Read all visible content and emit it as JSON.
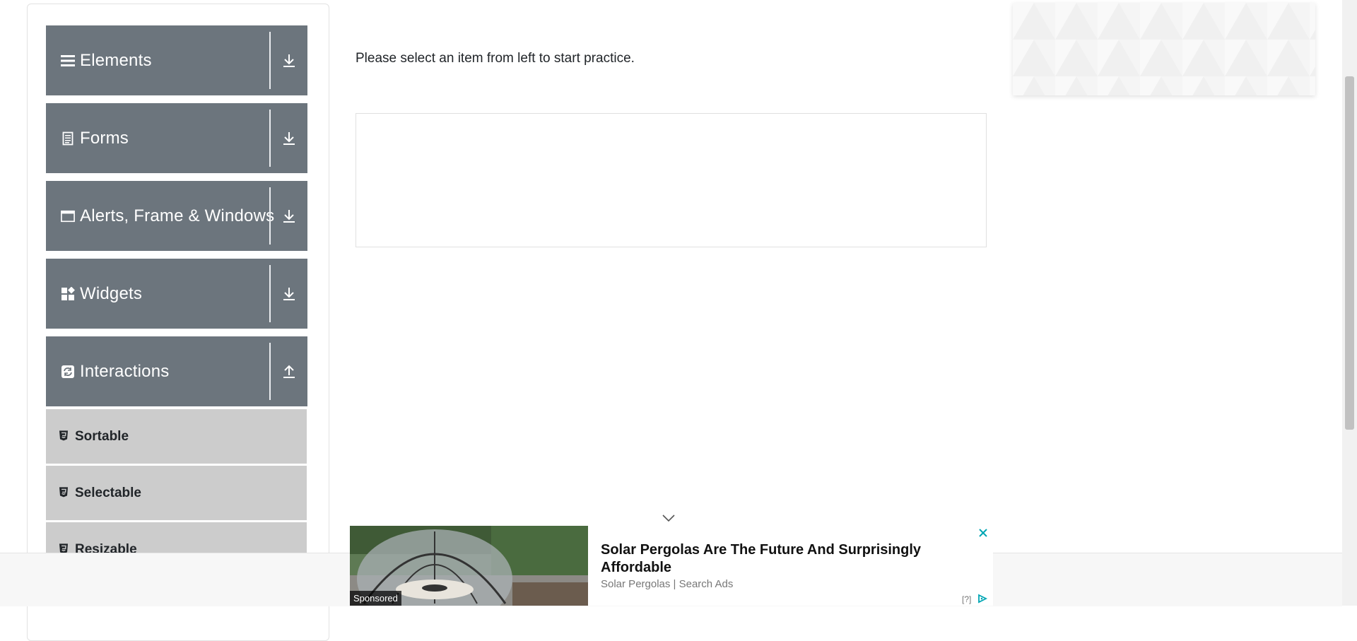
{
  "sidebar": {
    "groups": [
      {
        "label": "Elements",
        "icon": "menu-icon",
        "toggle": "download-arrow-icon"
      },
      {
        "label": "Forms",
        "icon": "document-icon",
        "toggle": "download-arrow-icon"
      },
      {
        "label": "Alerts, Frame & Windows",
        "icon": "window-icon",
        "toggle": "download-arrow-icon"
      },
      {
        "label": "Widgets",
        "icon": "widgets-icon",
        "toggle": "download-arrow-icon"
      },
      {
        "label": "Interactions",
        "icon": "refresh-icon",
        "toggle": "upload-arrow-icon"
      }
    ],
    "interaction_items": [
      {
        "label": "Sortable",
        "icon": "html5-icon"
      },
      {
        "label": "Selectable",
        "icon": "html5-icon"
      },
      {
        "label": "Resizable",
        "icon": "html5-icon"
      }
    ]
  },
  "main": {
    "prompt": "Please select an item from left to start practice."
  },
  "ad": {
    "headline": "Solar Pergolas Are The Future And Surprisingly Affordable",
    "source": "Solar Pergolas | Search Ads",
    "sponsored": "Sponsored",
    "help": "[?]",
    "close_icon": "close-icon",
    "info_icon": "adchoices-icon",
    "collapse_icon": "chevron-down-icon"
  },
  "colors": {
    "group_header_bg": "#6c757d",
    "sub_item_bg": "#cccccc",
    "ad_accent": "#00a6b4"
  }
}
